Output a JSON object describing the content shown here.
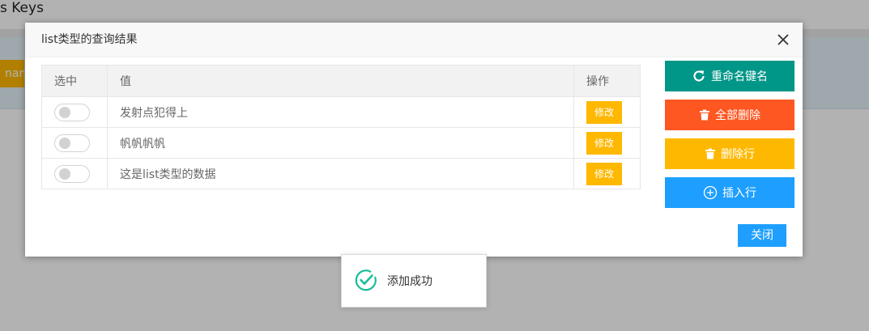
{
  "background": {
    "page_title": "s Keys",
    "chip_label": "nam"
  },
  "modal": {
    "title": "list类型的查询结果",
    "table": {
      "headers": [
        "选中",
        "值",
        "操作"
      ],
      "rows": [
        {
          "value": "发射点犯得上",
          "action": "修改"
        },
        {
          "value": "帆帆帆帆",
          "action": "修改"
        },
        {
          "value": "这是list类型的数据",
          "action": "修改"
        }
      ]
    },
    "side_buttons": {
      "rename": "重命名键名",
      "delete_all": "全部删除",
      "delete_row": "删除行",
      "insert_row": "插入行"
    },
    "close_label": "关闭"
  },
  "toast": {
    "message": "添加成功"
  },
  "colors": {
    "teal": "#009688",
    "orange": "#ff5722",
    "amber": "#ffb800",
    "blue": "#1e9fff",
    "success": "#19be9b"
  }
}
